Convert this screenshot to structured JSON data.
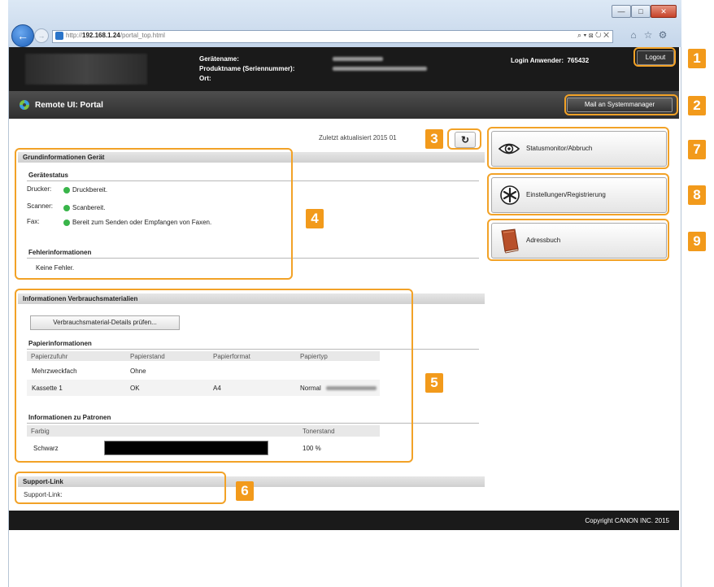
{
  "browser": {
    "url_prefix": "http://",
    "url_host": "192.168.1.24",
    "url_path": "/portal_top.html",
    "address_tools": "⌕ ▾ ⊠ ↻ ✕",
    "win_min": "—",
    "win_max": "□",
    "win_close": "✕"
  },
  "header": {
    "device_name_label": "Gerätename:",
    "product_name_label": "Produktname (Seriennummer):",
    "location_label": "Ort:",
    "login_label": "Login Anwender:",
    "login_value": "765432",
    "logout_button": "Logout"
  },
  "portal": {
    "title": "Remote UI: Portal",
    "mail_button": "Mail an Systemmanager",
    "last_updated": "Zuletzt aktualisiert 2015 01"
  },
  "callouts": [
    "1",
    "2",
    "3",
    "4",
    "5",
    "6",
    "7",
    "8",
    "9"
  ],
  "basic_info": {
    "header": "Grundinformationen Gerät",
    "status_title": "Gerätestatus",
    "rows": [
      {
        "label": "Drucker:",
        "status": "Druckbereit."
      },
      {
        "label": "Scanner:",
        "status": "Scanbereit."
      },
      {
        "label": "Fax:",
        "status": "Bereit zum Senden oder Empfangen von Faxen."
      }
    ],
    "error_title": "Fehlerinformationen",
    "error_text": "Keine Fehler."
  },
  "consumables": {
    "header": "Informationen Verbrauchsmaterialien",
    "check_button": "Verbrauchsmaterial-Details prüfen...",
    "paper_title": "Papierinformationen",
    "paper_columns": [
      "Papierzufuhr",
      "Papierstand",
      "Papierformat",
      "Papiertyp"
    ],
    "paper_rows": [
      {
        "source": "Mehrzweckfach",
        "level": "Ohne",
        "format": "",
        "type": ""
      },
      {
        "source": "Kassette 1",
        "level": "OK",
        "format": "A4",
        "type": "Normal"
      }
    ],
    "cartridge_title": "Informationen zu Patronen",
    "cartridge_columns": [
      "Farbig",
      "",
      "Tonerstand"
    ],
    "cartridge_rows": [
      {
        "color": "Schwarz",
        "level_text": "100 %",
        "level_fraction": 1.0
      }
    ]
  },
  "support": {
    "header": "Support-Link",
    "link": "Support-Link:"
  },
  "right_menu": {
    "status_monitor": "Statusmonitor/Abbruch",
    "settings": "Einstellungen/Registrierung",
    "address_book": "Adressbuch"
  },
  "footer": {
    "copyright": "Copyright CANON INC. 2015"
  },
  "colors": {
    "callout": "#f29a1b",
    "status_ok": "#39b54a",
    "header_bg": "#1a1a1a"
  }
}
